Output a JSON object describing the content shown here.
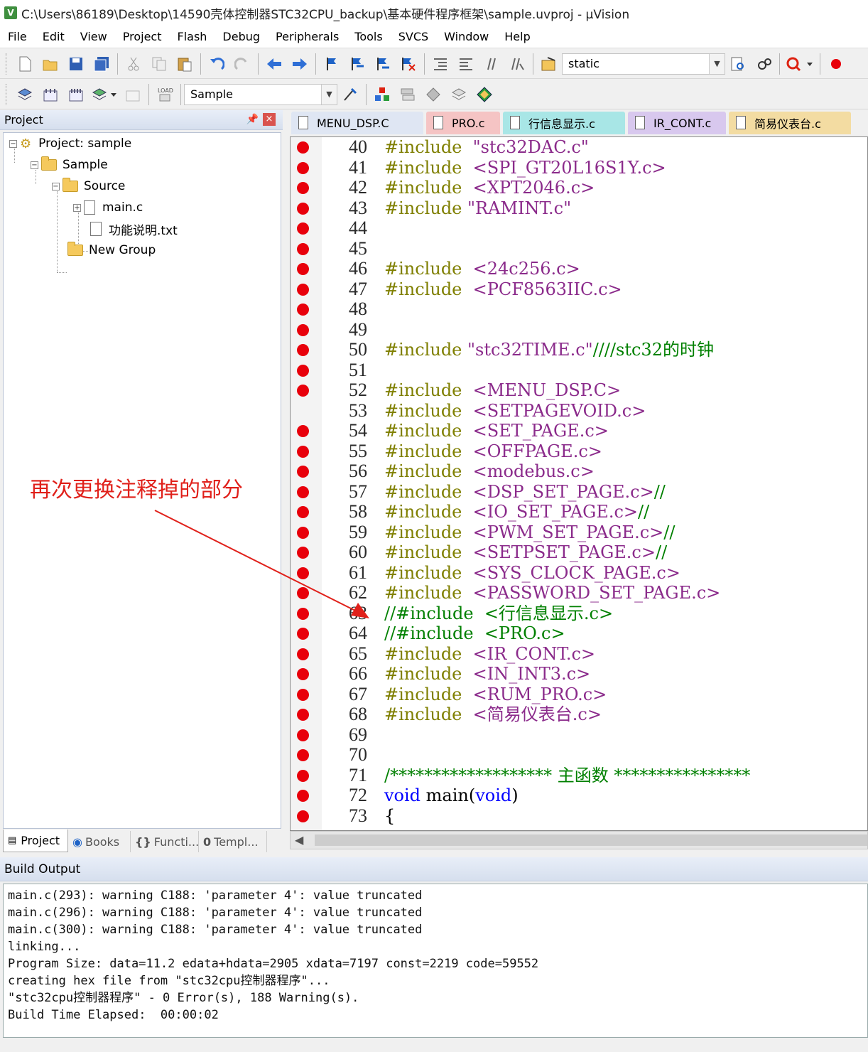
{
  "window": {
    "title": "C:\\Users\\86189\\Desktop\\14590壳体控制器STC32CPU_backup\\基本硬件程序框架\\sample.uvproj - µVision",
    "icon_name": "uvision-app-icon"
  },
  "menu": [
    "File",
    "Edit",
    "View",
    "Project",
    "Flash",
    "Debug",
    "Peripherals",
    "Tools",
    "SVCS",
    "Window",
    "Help"
  ],
  "toolbar1": {
    "search_value": "static"
  },
  "toolbar2": {
    "target_value": "Sample"
  },
  "project_panel": {
    "title": "Project",
    "tree": {
      "project": "Project: sample",
      "target": "Sample",
      "source_group": "Source",
      "file_main": "main.c",
      "file_txt": "功能说明.txt",
      "new_group": "New Group"
    },
    "tabs": [
      "Project",
      "Books",
      "Functi...",
      "Templ..."
    ]
  },
  "editor": {
    "tabs": [
      "MENU_DSP.C",
      "PRO.c",
      "行信息显示.c",
      "IR_CONT.c",
      "简易仪表台.c"
    ],
    "lines": [
      {
        "n": "40",
        "bp": true,
        "parts": [
          [
            "kw-inc",
            "#include  "
          ],
          [
            "str",
            "\"stc32DAC.c\""
          ]
        ]
      },
      {
        "n": "41",
        "bp": true,
        "parts": [
          [
            "kw-inc",
            "#include  "
          ],
          [
            "str",
            "<SPI_GT20L16S1Y.c>"
          ]
        ]
      },
      {
        "n": "42",
        "bp": true,
        "parts": [
          [
            "kw-inc",
            "#include  "
          ],
          [
            "str",
            "<XPT2046.c>"
          ]
        ]
      },
      {
        "n": "43",
        "bp": true,
        "parts": [
          [
            "kw-inc",
            "#include "
          ],
          [
            "str",
            "\"RAMINT.c\""
          ]
        ]
      },
      {
        "n": "44",
        "bp": true,
        "parts": []
      },
      {
        "n": "45",
        "bp": true,
        "parts": []
      },
      {
        "n": "46",
        "bp": true,
        "parts": [
          [
            "kw-inc",
            "#include  "
          ],
          [
            "str",
            "<24c256.c>"
          ]
        ]
      },
      {
        "n": "47",
        "bp": true,
        "parts": [
          [
            "kw-inc",
            "#include  "
          ],
          [
            "str",
            "<PCF8563IIC.c>"
          ]
        ]
      },
      {
        "n": "48",
        "bp": true,
        "parts": []
      },
      {
        "n": "49",
        "bp": true,
        "parts": []
      },
      {
        "n": "50",
        "bp": true,
        "parts": [
          [
            "kw-inc",
            "#include "
          ],
          [
            "str",
            "\"stc32TIME.c\""
          ],
          [
            "cmt",
            "////stc32的时钟"
          ]
        ]
      },
      {
        "n": "51",
        "bp": true,
        "parts": []
      },
      {
        "n": "52",
        "bp": true,
        "parts": [
          [
            "kw-inc",
            "#include  "
          ],
          [
            "str",
            "<MENU_DSP.C>"
          ]
        ]
      },
      {
        "n": "53",
        "bp": false,
        "parts": [
          [
            "kw-inc",
            "#include  "
          ],
          [
            "str",
            "<SETPAGEVOID.c>"
          ]
        ]
      },
      {
        "n": "54",
        "bp": true,
        "parts": [
          [
            "kw-inc",
            "#include  "
          ],
          [
            "str",
            "<SET_PAGE.c>"
          ]
        ]
      },
      {
        "n": "55",
        "bp": true,
        "parts": [
          [
            "kw-inc",
            "#include  "
          ],
          [
            "str",
            "<OFFPAGE.c>"
          ]
        ]
      },
      {
        "n": "56",
        "bp": true,
        "parts": [
          [
            "kw-inc",
            "#include  "
          ],
          [
            "str",
            "<modebus.c>"
          ]
        ]
      },
      {
        "n": "57",
        "bp": true,
        "parts": [
          [
            "kw-inc",
            "#include  "
          ],
          [
            "str",
            "<DSP_SET_PAGE.c>"
          ],
          [
            "cmt",
            "//"
          ]
        ]
      },
      {
        "n": "58",
        "bp": true,
        "parts": [
          [
            "kw-inc",
            "#include  "
          ],
          [
            "str",
            "<IO_SET_PAGE.c>"
          ],
          [
            "cmt",
            "//"
          ]
        ]
      },
      {
        "n": "59",
        "bp": true,
        "parts": [
          [
            "kw-inc",
            "#include  "
          ],
          [
            "str",
            "<PWM_SET_PAGE.c>"
          ],
          [
            "cmt",
            "//"
          ]
        ]
      },
      {
        "n": "60",
        "bp": true,
        "parts": [
          [
            "kw-inc",
            "#include  "
          ],
          [
            "str",
            "<SETPSET_PAGE.c>"
          ],
          [
            "cmt",
            "//"
          ]
        ]
      },
      {
        "n": "61",
        "bp": true,
        "parts": [
          [
            "kw-inc",
            "#include  "
          ],
          [
            "str",
            "<SYS_CLOCK_PAGE.c>"
          ]
        ]
      },
      {
        "n": "62",
        "bp": true,
        "parts": [
          [
            "kw-inc",
            "#include  "
          ],
          [
            "str",
            "<PASSWORD_SET_PAGE.c>"
          ]
        ]
      },
      {
        "n": "63",
        "bp": true,
        "parts": [
          [
            "cmt",
            "//#include  <行信息显示.c>"
          ]
        ]
      },
      {
        "n": "64",
        "bp": true,
        "parts": [
          [
            "cmt",
            "//#include  <PRO.c>"
          ]
        ]
      },
      {
        "n": "65",
        "bp": true,
        "parts": [
          [
            "kw-inc",
            "#include  "
          ],
          [
            "str",
            "<IR_CONT.c>"
          ]
        ]
      },
      {
        "n": "66",
        "bp": true,
        "parts": [
          [
            "kw-inc",
            "#include  "
          ],
          [
            "str",
            "<IN_INT3.c>"
          ]
        ]
      },
      {
        "n": "67",
        "bp": true,
        "parts": [
          [
            "kw-inc",
            "#include  "
          ],
          [
            "str",
            "<RUM_PRO.c>"
          ]
        ]
      },
      {
        "n": "68",
        "bp": true,
        "parts": [
          [
            "kw-inc",
            "#include  "
          ],
          [
            "str",
            "<简易仪表台.c>"
          ]
        ]
      },
      {
        "n": "69",
        "bp": true,
        "parts": []
      },
      {
        "n": "70",
        "bp": true,
        "parts": []
      },
      {
        "n": "71",
        "bp": true,
        "parts": [
          [
            "cmt",
            "/******************* 主函数 ****************"
          ]
        ]
      },
      {
        "n": "72",
        "bp": true,
        "parts": [
          [
            "kw",
            "void"
          ],
          [
            "txt",
            " main("
          ],
          [
            "kw",
            "void"
          ],
          [
            "txt",
            ")"
          ]
        ]
      },
      {
        "n": "73",
        "bp": true,
        "parts": [
          [
            "txt",
            "{"
          ]
        ]
      }
    ]
  },
  "build_output": {
    "title": "Build Output",
    "lines": [
      "main.c(293): warning C188: 'parameter 4': value truncated",
      "main.c(296): warning C188: 'parameter 4': value truncated",
      "main.c(300): warning C188: 'parameter 4': value truncated",
      "linking...",
      "Program Size: data=11.2 edata+hdata=2905 xdata=7197 const=2219 code=59552",
      "creating hex file from \"stc32cpu控制器程序\"...",
      "\"stc32cpu控制器程序\" - 0 Error(s), 188 Warning(s).",
      "Build Time Elapsed:  00:00:02"
    ]
  },
  "annotation": {
    "text": "再次更换注释掉的部分",
    "color": "#e0201a"
  }
}
